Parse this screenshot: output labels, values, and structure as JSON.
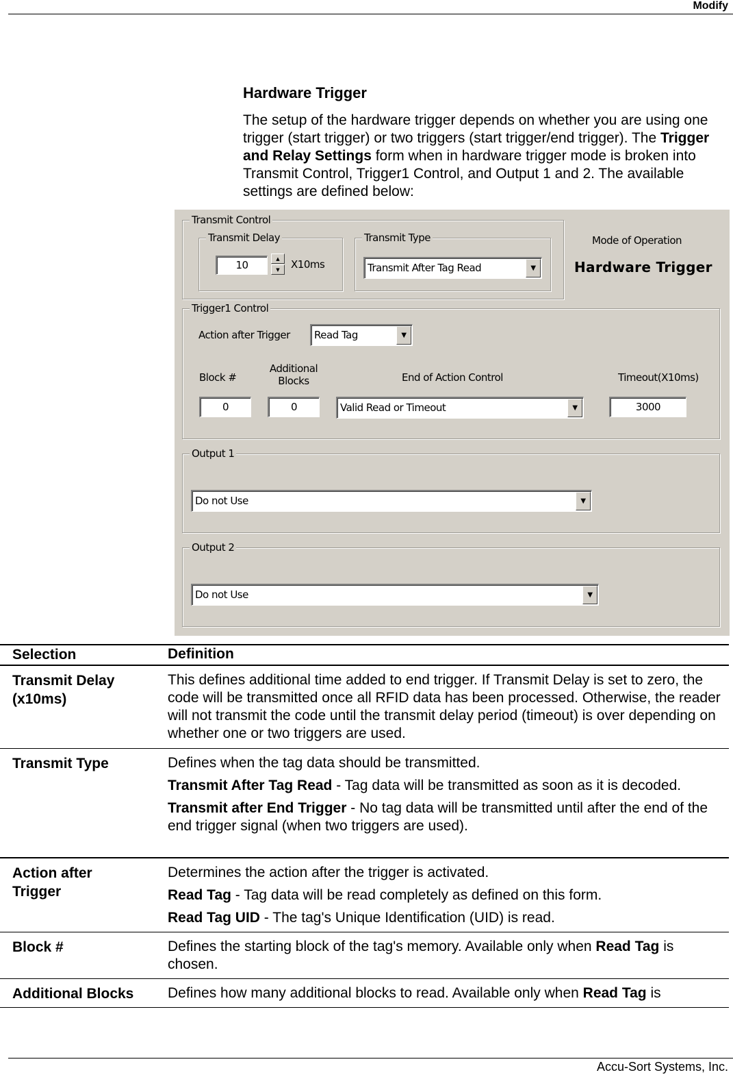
{
  "header": {
    "section": "Modify"
  },
  "section_title": "Hardware Trigger",
  "intro": {
    "part1": "The setup of the hardware trigger depends on whether you are using one trigger (start trigger) or two triggers (start trigger/end trigger). The ",
    "bold": "Trigger and Relay Settings",
    "part2": " form when in hardware trigger mode is broken into Transmit Control, Trigger1 Control, and Output 1 and 2. The available settings are defined below:"
  },
  "dialog": {
    "transmit_control": {
      "label": "Transmit Control",
      "transmit_delay": {
        "label": "Transmit Delay",
        "value": "10",
        "unit": "X10ms",
        "spin_up": "▲",
        "spin_down": "▼"
      },
      "transmit_type": {
        "label": "Transmit Type",
        "value": "Transmit After Tag Read"
      }
    },
    "mode": {
      "label": "Mode of Operation",
      "value": "Hardware Trigger"
    },
    "trigger1_control": {
      "label": "Trigger1 Control",
      "action_after_trigger": {
        "label": "Action after Trigger",
        "value": "Read Tag"
      },
      "block_num": {
        "label": "Block #",
        "value": "0"
      },
      "additional_blocks": {
        "label_line1": "Additional",
        "label_line2": "Blocks",
        "value": "0"
      },
      "end_of_action_control": {
        "label": "End of Action Control",
        "value": "Valid Read or Timeout"
      },
      "timeout": {
        "label": "Timeout(X10ms)",
        "value": "3000"
      }
    },
    "output1": {
      "label": "Output 1",
      "value": "Do not Use"
    },
    "output2": {
      "label": "Output 2",
      "value": "Do not Use"
    },
    "dropdown_glyph": "▼"
  },
  "table": {
    "headers": [
      "Selection",
      "Definition"
    ],
    "rows": [
      {
        "selection": "Transmit Delay (x10ms)",
        "definition": [
          {
            "text": "This defines additional time added to end trigger. If Transmit Delay is set to zero, the code will be transmitted once all RFID data has been processed. Otherwise, the reader will not transmit the code until the transmit delay period (timeout) is over depending on whether one or two triggers are used."
          }
        ]
      },
      {
        "selection": "Transmit Type",
        "definition": [
          {
            "text": "Defines when the tag data should be transmitted."
          },
          {
            "bold": "Transmit After Tag Read",
            "text": " - Tag data will be transmitted as soon as it is decoded."
          },
          {
            "bold": "Transmit after End Trigger",
            "text": " - No tag data will be transmitted until after the end of the end trigger signal (when two triggers are used)."
          }
        ]
      },
      {
        "selection": "Action after Trigger",
        "definition": [
          {
            "text": "Determines the action after the trigger is activated."
          },
          {
            "bold": "Read Tag",
            "text": " - Tag data will be read completely as defined on this form."
          },
          {
            "bold": "Read Tag UID",
            "text": " - The tag's Unique Identification (UID) is read."
          }
        ]
      },
      {
        "selection": "Block #",
        "definition": [
          {
            "text": "Defines the starting block of the tag's memory. Available only when ",
            "bold_mid": "Read Tag",
            "text_after": " is chosen."
          }
        ]
      },
      {
        "selection": "Additional Blocks",
        "definition": [
          {
            "text": "Defines how many additional blocks to read. Available only when ",
            "bold_mid": "Read Tag",
            "text_after": " is"
          }
        ]
      }
    ]
  },
  "footer": {
    "company": "Accu-Sort Systems, Inc."
  }
}
